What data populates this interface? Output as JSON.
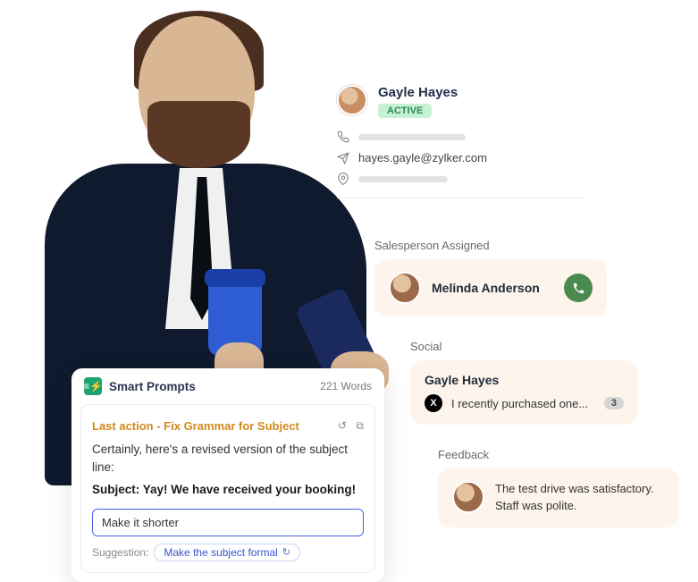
{
  "contact": {
    "name": "Gayle Hayes",
    "status": "ACTIVE",
    "email": "hayes.gayle@zylker.com"
  },
  "salesperson": {
    "section_label": "Salesperson Assigned",
    "name": "Melinda Anderson"
  },
  "social": {
    "section_label": "Social",
    "author": "Gayle Hayes",
    "text": "I recently purchased one...",
    "count": "3"
  },
  "feedback": {
    "section_label": "Feedback",
    "text": "The test drive was satisfactory. Staff was polite."
  },
  "prompts": {
    "title": "Smart Prompts",
    "word_count": "221 Words",
    "last_action": "Last action - Fix Grammar for Subject",
    "body_text": "Certainly, here's a revised version of the subject line:",
    "subject_line": "Subject: Yay! We have received your booking!",
    "input_value": "Make it shorter",
    "suggestion_label": "Suggestion:",
    "suggestion_text": "Make the subject formal"
  }
}
